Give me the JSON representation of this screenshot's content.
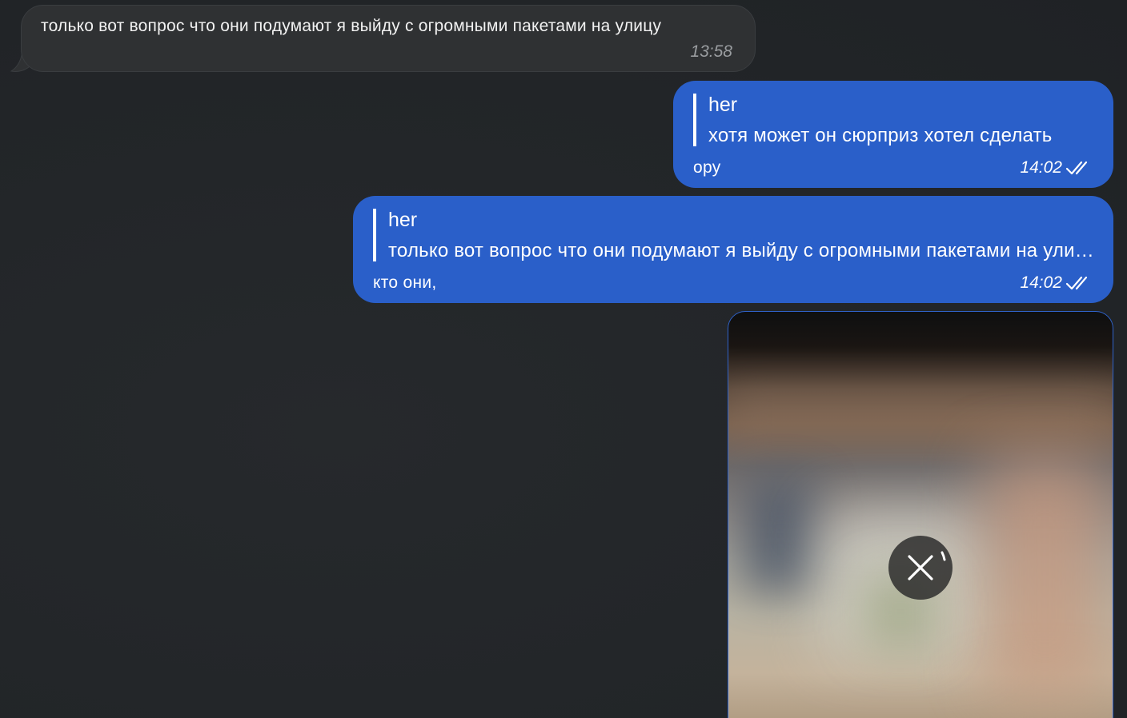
{
  "messages": {
    "incoming": {
      "text": "только вот вопрос что они подумают я выйду с огромными пакетами на улицу",
      "time": "13:58"
    },
    "outgoing": [
      {
        "reply_author": "her",
        "reply_text": "хотя может он сюрприз хотел сделать",
        "text": "ору",
        "time": "14:02",
        "status_icon": "double-check-icon"
      },
      {
        "reply_author": "her",
        "reply_text": "только вот вопрос что они подумают я выйду с огромными пакетами на улицу",
        "text": "кто они,",
        "time": "14:02",
        "status_icon": "double-check-icon"
      }
    ],
    "media": {
      "state": "uploading",
      "action_icon": "close-icon"
    }
  },
  "colors": {
    "background": "#232629",
    "incoming_bubble": "#2f3133",
    "outgoing_bubble": "#2a5fc9",
    "timestamp_incoming": "#9a9da0"
  }
}
